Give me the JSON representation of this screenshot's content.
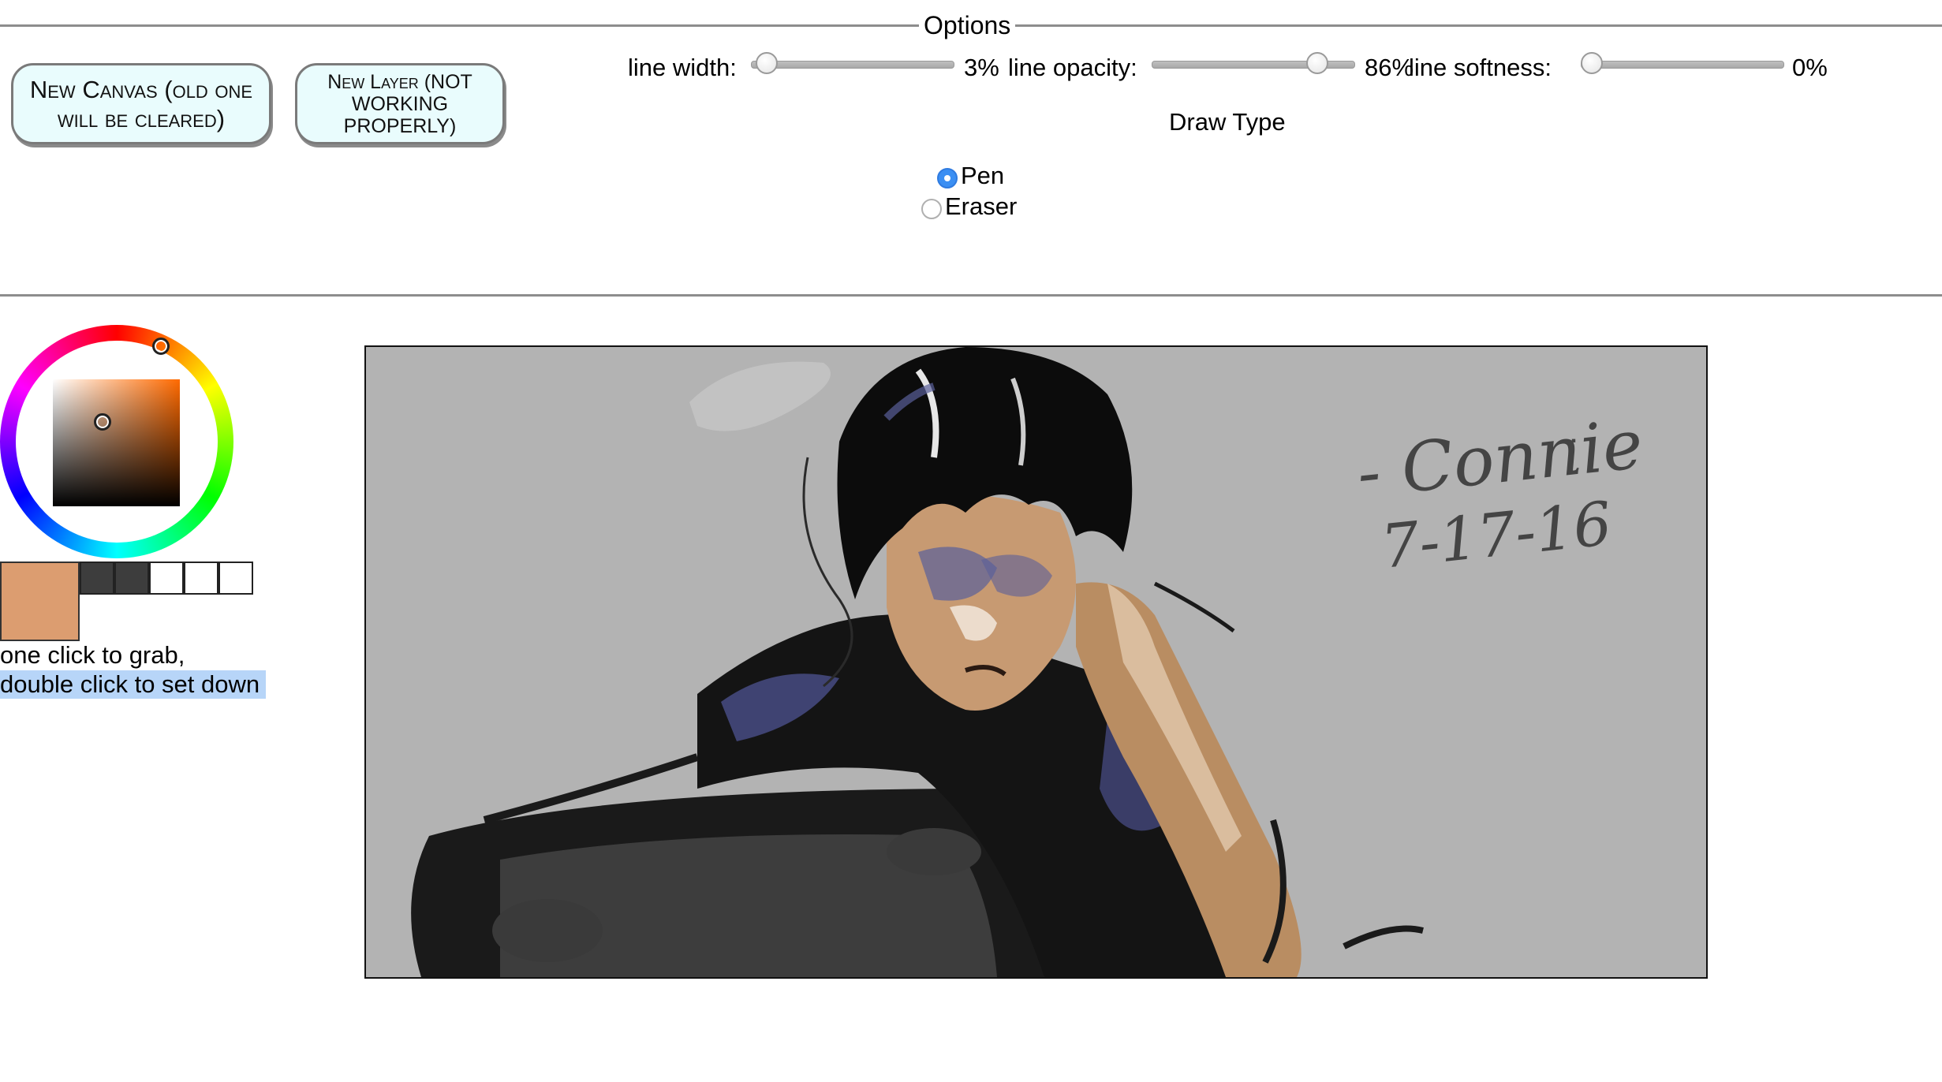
{
  "options": {
    "legend": "Options",
    "sliders": [
      {
        "label": "line width:",
        "value_text": "3%",
        "value": 0.03
      },
      {
        "label": "line opacity:",
        "value_text": "86%",
        "value": 0.86
      },
      {
        "label": "line softness:",
        "value_text": "0%",
        "value": 0.0
      }
    ],
    "draw_type": {
      "label": "Draw Type",
      "options": [
        {
          "label": "Pen",
          "checked": true
        },
        {
          "label": "Eraser",
          "checked": false
        }
      ]
    }
  },
  "buttons": {
    "new_canvas": "New Canvas (old one will be cleared)",
    "new_layer": "New Layer (NOT WORKING PROPERLY)"
  },
  "color_picker": {
    "current_color": "#dc9d70",
    "palette": [
      "#3d3d3d",
      "#3d3d3d",
      "#ffffff",
      "#ffffff",
      "#ffffff"
    ],
    "hint_line1": "one click to grab,",
    "hint_line2": "double click to set down"
  },
  "canvas": {
    "background": "#b3b3b3",
    "signature_name": "- Connie",
    "signature_date": "7-17-16",
    "signature_smile": "˙̮˙",
    "icons": [
      "hue-marker-icon",
      "saturation-marker-icon"
    ]
  }
}
